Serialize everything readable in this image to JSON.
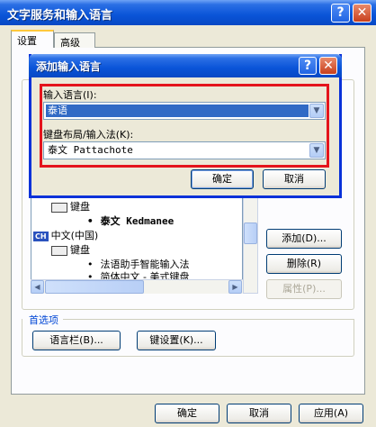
{
  "window": {
    "title": "文字服务和输入语言"
  },
  "tabs": [
    {
      "label": "设置"
    },
    {
      "label": "高级"
    }
  ],
  "tree": {
    "items": [
      {
        "text": "键盘"
      },
      {
        "text": "泰文 Kedmanee"
      },
      {
        "badge": "CH",
        "text": "中文(中国)"
      },
      {
        "text": "键盘"
      },
      {
        "text": "法语助手智能输入法"
      },
      {
        "text": "简体中文 - 美式键盘"
      }
    ]
  },
  "side_buttons": {
    "add": "添加(D)...",
    "remove": "删除(R)",
    "properties": "属性(P)..."
  },
  "preferences": {
    "label": "首选项",
    "language_bar": "语言栏(B)...",
    "key_settings": "键设置(K)..."
  },
  "footer": {
    "ok": "确定",
    "cancel": "取消",
    "apply": "应用(A)"
  },
  "dialog": {
    "title": "添加输入语言",
    "input_language_label": "输入语言(I):",
    "input_language_value": "泰语",
    "keyboard_layout_label": "键盘布局/输入法(K):",
    "keyboard_layout_value": "泰文 Pattachote",
    "ok": "确定",
    "cancel": "取消"
  },
  "colors": {
    "titlebar": "#0a54d8",
    "highlight_border": "#e4141c",
    "selection": "#316ac5"
  }
}
